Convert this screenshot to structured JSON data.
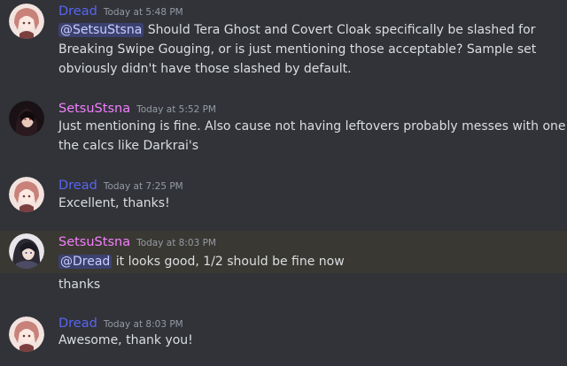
{
  "colors": {
    "dread": "#5865f2",
    "setsu": "#f47fff",
    "mention_bg": "#3c4270"
  },
  "messages": [
    {
      "author": "Dread",
      "timestamp": "Today at 5:48 PM",
      "mention": "@SetsuStsna",
      "lines": [
        " Should Tera Ghost and Covert Cloak specifically be slashed for",
        "Breaking Swipe Gouging, or is just mentioning those acceptable? Sample set",
        "obviously didn't have those slashed by default."
      ]
    },
    {
      "author": "SetsuStsna",
      "timestamp": "Today at 5:52 PM",
      "lines": [
        "Just mentioning is fine. Also cause not having leftovers probably messes with one of",
        "the calcs like Darkrai's"
      ]
    },
    {
      "author": "Dread",
      "timestamp": "Today at 7:25 PM",
      "lines": [
        "Excellent, thanks!"
      ]
    },
    {
      "author": "SetsuStsna",
      "timestamp": "Today at 8:03 PM",
      "mention": "@Dread",
      "lines": [
        " it looks good, 1/2 should be fine now",
        "thanks"
      ]
    },
    {
      "author": "Dread",
      "timestamp": "Today at 8:03 PM",
      "lines": [
        "Awesome, thank you!"
      ]
    }
  ]
}
